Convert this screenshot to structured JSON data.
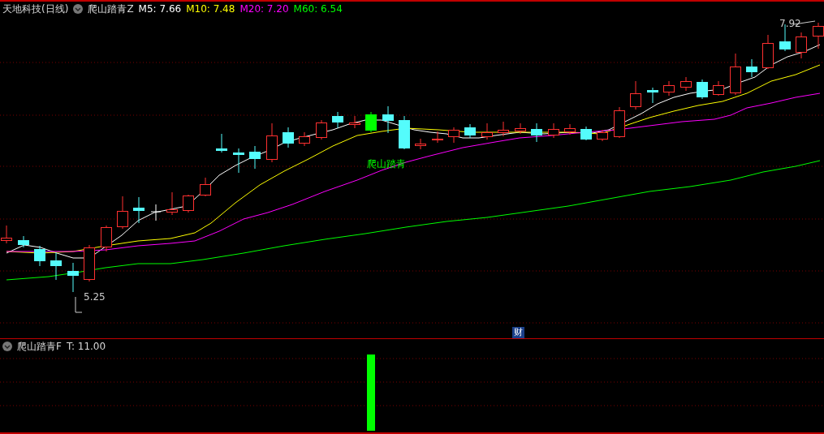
{
  "header": {
    "stock": "天地科技(日线)",
    "indicator": "爬山踏青Z",
    "averages": [
      {
        "label": "M5: 7.66",
        "color": "#ffffff"
      },
      {
        "label": "M10: 7.48",
        "color": "#ffff00"
      },
      {
        "label": "M20: 7.20",
        "color": "#ff00ff"
      },
      {
        "label": "M60: 6.54",
        "color": "#00ff00"
      }
    ]
  },
  "chart_labels": {
    "signal": "爬山踏青",
    "high": "7.92",
    "low": "5.25",
    "badge": "财"
  },
  "sub_pane": {
    "indicator": "爬山踏青F",
    "reading": "T: 11.00"
  }
}
